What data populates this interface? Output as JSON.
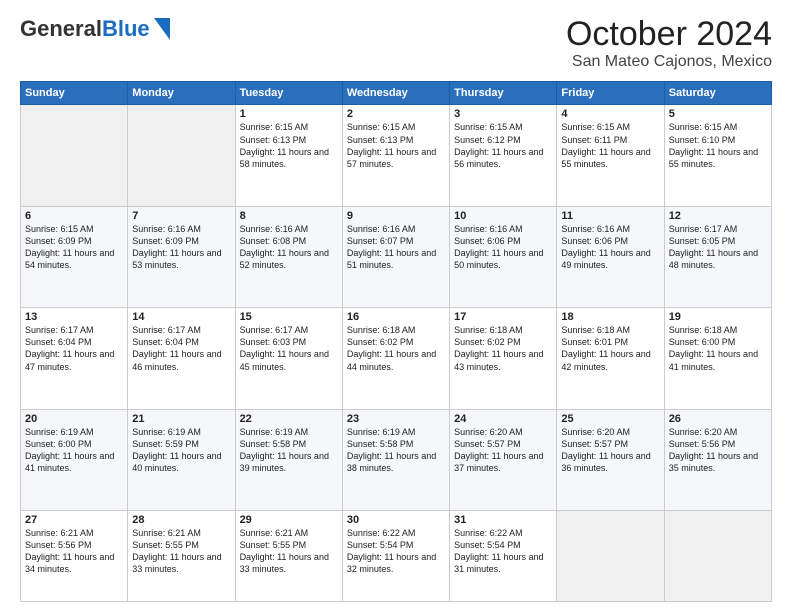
{
  "header": {
    "logo_general": "General",
    "logo_blue": "Blue",
    "month_title": "October 2024",
    "location": "San Mateo Cajonos, Mexico"
  },
  "days_of_week": [
    "Sunday",
    "Monday",
    "Tuesday",
    "Wednesday",
    "Thursday",
    "Friday",
    "Saturday"
  ],
  "weeks": [
    [
      {
        "day": "",
        "sunrise": "",
        "sunset": "",
        "daylight": ""
      },
      {
        "day": "",
        "sunrise": "",
        "sunset": "",
        "daylight": ""
      },
      {
        "day": "1",
        "sunrise": "Sunrise: 6:15 AM",
        "sunset": "Sunset: 6:13 PM",
        "daylight": "Daylight: 11 hours and 58 minutes."
      },
      {
        "day": "2",
        "sunrise": "Sunrise: 6:15 AM",
        "sunset": "Sunset: 6:13 PM",
        "daylight": "Daylight: 11 hours and 57 minutes."
      },
      {
        "day": "3",
        "sunrise": "Sunrise: 6:15 AM",
        "sunset": "Sunset: 6:12 PM",
        "daylight": "Daylight: 11 hours and 56 minutes."
      },
      {
        "day": "4",
        "sunrise": "Sunrise: 6:15 AM",
        "sunset": "Sunset: 6:11 PM",
        "daylight": "Daylight: 11 hours and 55 minutes."
      },
      {
        "day": "5",
        "sunrise": "Sunrise: 6:15 AM",
        "sunset": "Sunset: 6:10 PM",
        "daylight": "Daylight: 11 hours and 55 minutes."
      }
    ],
    [
      {
        "day": "6",
        "sunrise": "Sunrise: 6:15 AM",
        "sunset": "Sunset: 6:09 PM",
        "daylight": "Daylight: 11 hours and 54 minutes."
      },
      {
        "day": "7",
        "sunrise": "Sunrise: 6:16 AM",
        "sunset": "Sunset: 6:09 PM",
        "daylight": "Daylight: 11 hours and 53 minutes."
      },
      {
        "day": "8",
        "sunrise": "Sunrise: 6:16 AM",
        "sunset": "Sunset: 6:08 PM",
        "daylight": "Daylight: 11 hours and 52 minutes."
      },
      {
        "day": "9",
        "sunrise": "Sunrise: 6:16 AM",
        "sunset": "Sunset: 6:07 PM",
        "daylight": "Daylight: 11 hours and 51 minutes."
      },
      {
        "day": "10",
        "sunrise": "Sunrise: 6:16 AM",
        "sunset": "Sunset: 6:06 PM",
        "daylight": "Daylight: 11 hours and 50 minutes."
      },
      {
        "day": "11",
        "sunrise": "Sunrise: 6:16 AM",
        "sunset": "Sunset: 6:06 PM",
        "daylight": "Daylight: 11 hours and 49 minutes."
      },
      {
        "day": "12",
        "sunrise": "Sunrise: 6:17 AM",
        "sunset": "Sunset: 6:05 PM",
        "daylight": "Daylight: 11 hours and 48 minutes."
      }
    ],
    [
      {
        "day": "13",
        "sunrise": "Sunrise: 6:17 AM",
        "sunset": "Sunset: 6:04 PM",
        "daylight": "Daylight: 11 hours and 47 minutes."
      },
      {
        "day": "14",
        "sunrise": "Sunrise: 6:17 AM",
        "sunset": "Sunset: 6:04 PM",
        "daylight": "Daylight: 11 hours and 46 minutes."
      },
      {
        "day": "15",
        "sunrise": "Sunrise: 6:17 AM",
        "sunset": "Sunset: 6:03 PM",
        "daylight": "Daylight: 11 hours and 45 minutes."
      },
      {
        "day": "16",
        "sunrise": "Sunrise: 6:18 AM",
        "sunset": "Sunset: 6:02 PM",
        "daylight": "Daylight: 11 hours and 44 minutes."
      },
      {
        "day": "17",
        "sunrise": "Sunrise: 6:18 AM",
        "sunset": "Sunset: 6:02 PM",
        "daylight": "Daylight: 11 hours and 43 minutes."
      },
      {
        "day": "18",
        "sunrise": "Sunrise: 6:18 AM",
        "sunset": "Sunset: 6:01 PM",
        "daylight": "Daylight: 11 hours and 42 minutes."
      },
      {
        "day": "19",
        "sunrise": "Sunrise: 6:18 AM",
        "sunset": "Sunset: 6:00 PM",
        "daylight": "Daylight: 11 hours and 41 minutes."
      }
    ],
    [
      {
        "day": "20",
        "sunrise": "Sunrise: 6:19 AM",
        "sunset": "Sunset: 6:00 PM",
        "daylight": "Daylight: 11 hours and 41 minutes."
      },
      {
        "day": "21",
        "sunrise": "Sunrise: 6:19 AM",
        "sunset": "Sunset: 5:59 PM",
        "daylight": "Daylight: 11 hours and 40 minutes."
      },
      {
        "day": "22",
        "sunrise": "Sunrise: 6:19 AM",
        "sunset": "Sunset: 5:58 PM",
        "daylight": "Daylight: 11 hours and 39 minutes."
      },
      {
        "day": "23",
        "sunrise": "Sunrise: 6:19 AM",
        "sunset": "Sunset: 5:58 PM",
        "daylight": "Daylight: 11 hours and 38 minutes."
      },
      {
        "day": "24",
        "sunrise": "Sunrise: 6:20 AM",
        "sunset": "Sunset: 5:57 PM",
        "daylight": "Daylight: 11 hours and 37 minutes."
      },
      {
        "day": "25",
        "sunrise": "Sunrise: 6:20 AM",
        "sunset": "Sunset: 5:57 PM",
        "daylight": "Daylight: 11 hours and 36 minutes."
      },
      {
        "day": "26",
        "sunrise": "Sunrise: 6:20 AM",
        "sunset": "Sunset: 5:56 PM",
        "daylight": "Daylight: 11 hours and 35 minutes."
      }
    ],
    [
      {
        "day": "27",
        "sunrise": "Sunrise: 6:21 AM",
        "sunset": "Sunset: 5:56 PM",
        "daylight": "Daylight: 11 hours and 34 minutes."
      },
      {
        "day": "28",
        "sunrise": "Sunrise: 6:21 AM",
        "sunset": "Sunset: 5:55 PM",
        "daylight": "Daylight: 11 hours and 33 minutes."
      },
      {
        "day": "29",
        "sunrise": "Sunrise: 6:21 AM",
        "sunset": "Sunset: 5:55 PM",
        "daylight": "Daylight: 11 hours and 33 minutes."
      },
      {
        "day": "30",
        "sunrise": "Sunrise: 6:22 AM",
        "sunset": "Sunset: 5:54 PM",
        "daylight": "Daylight: 11 hours and 32 minutes."
      },
      {
        "day": "31",
        "sunrise": "Sunrise: 6:22 AM",
        "sunset": "Sunset: 5:54 PM",
        "daylight": "Daylight: 11 hours and 31 minutes."
      },
      {
        "day": "",
        "sunrise": "",
        "sunset": "",
        "daylight": ""
      },
      {
        "day": "",
        "sunrise": "",
        "sunset": "",
        "daylight": ""
      }
    ]
  ]
}
